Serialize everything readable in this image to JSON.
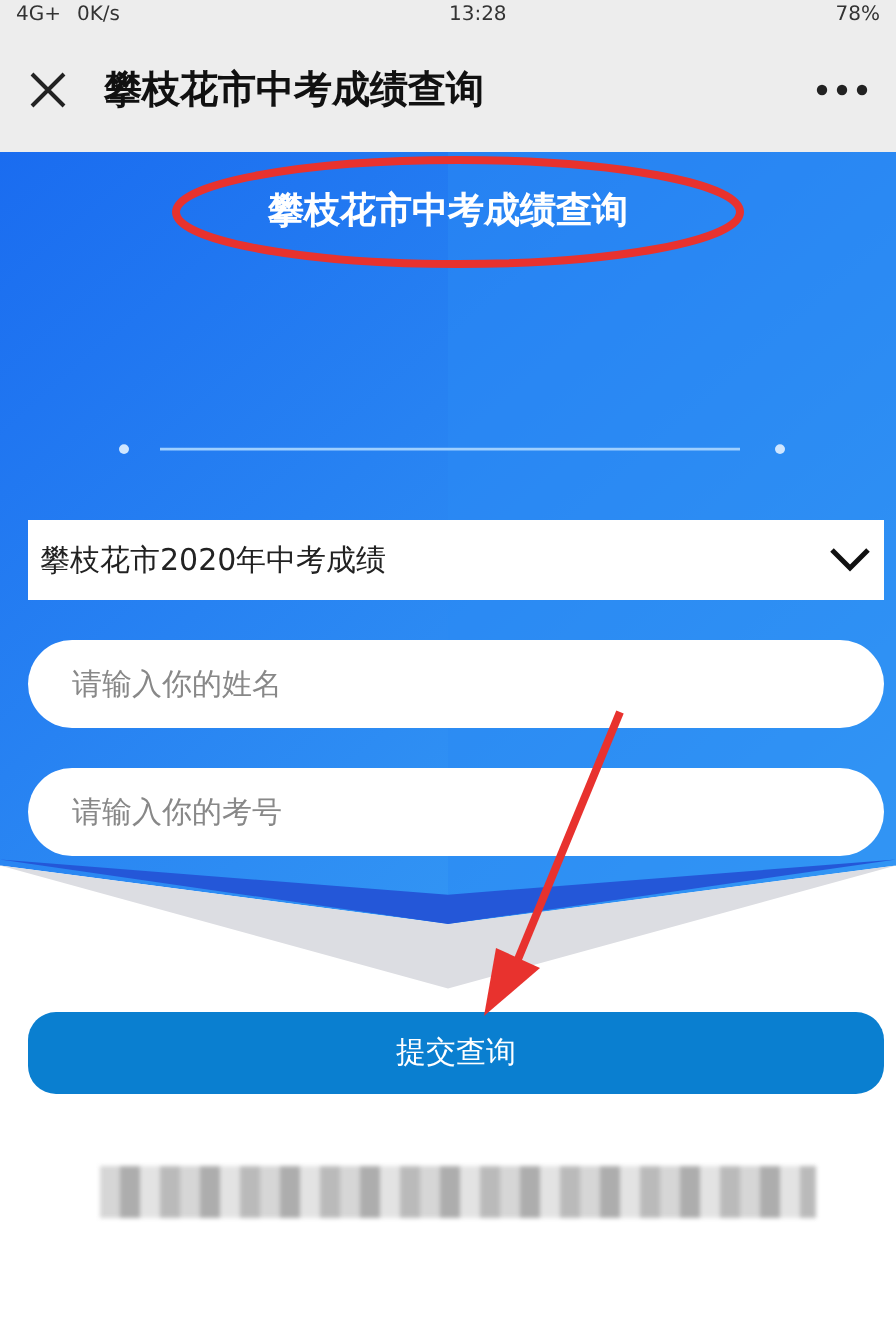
{
  "status_bar": {
    "network": "4G+",
    "speed": "0K/s",
    "time": "13:28",
    "battery": "78%"
  },
  "nav": {
    "title": "攀枝花市中考成绩查询"
  },
  "banner": {
    "title": "攀枝花市中考成绩查询"
  },
  "form": {
    "select": {
      "value": "攀枝花市2020年中考成绩"
    },
    "fields": [
      {
        "placeholder": "请输入你的姓名"
      },
      {
        "placeholder": "请输入你的考号"
      }
    ],
    "submit": "提交查询"
  }
}
